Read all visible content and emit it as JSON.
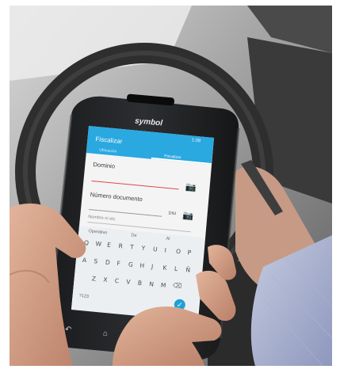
{
  "brand": "symbol",
  "screen": {
    "status_time": "1:09",
    "app_title": "Fiscalizar",
    "tabs": [
      "Ubicación",
      "Fiscalizar"
    ],
    "fields": [
      {
        "label": "Dominio",
        "value": ""
      },
      {
        "label": "Número documento",
        "value": ""
      },
      {
        "label": "Nombre ni etc",
        "value": ""
      }
    ],
    "doc_type": "DNI",
    "suggestions": [
      "Operativo",
      "De",
      "Al"
    ],
    "keyboard_rows": [
      [
        "Q",
        "W",
        "E",
        "R",
        "T",
        "Y",
        "U",
        "I",
        "O",
        "P"
      ],
      [
        "A",
        "S",
        "D",
        "F",
        "G",
        "H",
        "J",
        "K",
        "L",
        "Ñ"
      ],
      [
        "Z",
        "X",
        "C",
        "V",
        "B",
        "N",
        "M"
      ]
    ],
    "symbols_key": "?123"
  },
  "colors": {
    "app_bar": "#2aa8e0",
    "accent": "#1ea0d8",
    "error_underline": "#e04848",
    "phone_body": "#222426"
  },
  "icons": [
    "camera-icon",
    "camera-icon",
    "backspace-icon",
    "check-icon",
    "back-nav-icon",
    "home-nav-icon"
  ]
}
